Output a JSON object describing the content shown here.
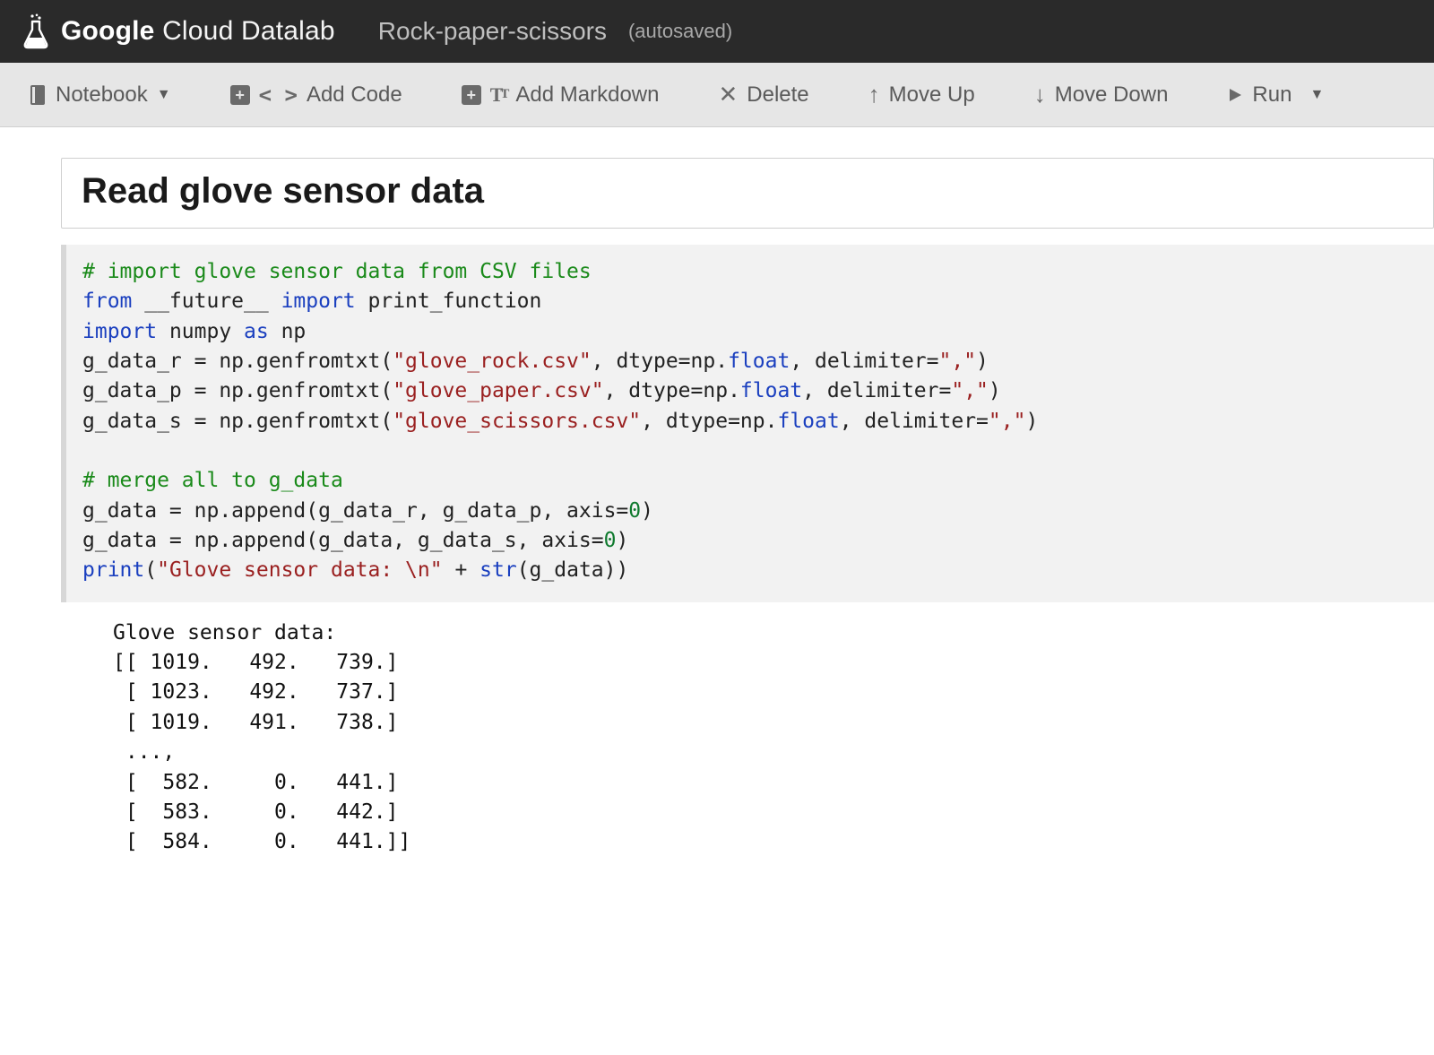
{
  "header": {
    "brand_google": "Google",
    "brand_rest": " Cloud Datalab",
    "file_title": "Rock-paper-scissors",
    "autosaved": "(autosaved)"
  },
  "toolbar": {
    "notebook_label": "Notebook",
    "add_code_label": "Add Code",
    "add_markdown_label": "Add Markdown",
    "delete_label": "Delete",
    "move_up_label": "Move Up",
    "move_down_label": "Move Down",
    "run_label": "Run"
  },
  "cells": {
    "markdown_heading": "Read glove sensor data",
    "code": {
      "c1": "# import glove sensor data from CSV files",
      "l2_from": "from",
      "l2_future": " __future__ ",
      "l2_import": "import",
      "l2_pf": " print_function",
      "l3_import": "import",
      "l3_np": " numpy ",
      "l3_as": "as",
      "l3_np2": " np",
      "l4a": "g_data_r = np.genfromtxt(",
      "l4s": "\"glove_rock.csv\"",
      "l4b": ", dtype=np.",
      "l4f": "float",
      "l4c": ", delimiter=",
      "l4d": "\",\"",
      "l4e": ")",
      "l5a": "g_data_p = np.genfromtxt(",
      "l5s": "\"glove_paper.csv\"",
      "l5b": ", dtype=np.",
      "l5f": "float",
      "l5c": ", delimiter=",
      "l5d": "\",\"",
      "l5e": ")",
      "l6a": "g_data_s = np.genfromtxt(",
      "l6s": "\"glove_scissors.csv\"",
      "l6b": ", dtype=np.",
      "l6f": "float",
      "l6c": ", delimiter=",
      "l6d": "\",\"",
      "l6e": ")",
      "c2": "# merge all to g_data",
      "l8a": "g_data = np.append(g_data_r, g_data_p, axis=",
      "l8n": "0",
      "l8b": ")",
      "l9a": "g_data = np.append(g_data, g_data_s, axis=",
      "l9n": "0",
      "l9b": ")",
      "l10p": "print",
      "l10a": "(",
      "l10s": "\"Glove sensor data: \\n\"",
      "l10b": " + ",
      "l10str": "str",
      "l10c": "(g_data))"
    },
    "output": "Glove sensor data: \n[[ 1019.   492.   739.]\n [ 1023.   492.   737.]\n [ 1019.   491.   738.]\n ..., \n [  582.     0.   441.]\n [  583.     0.   442.]\n [  584.     0.   441.]]"
  }
}
